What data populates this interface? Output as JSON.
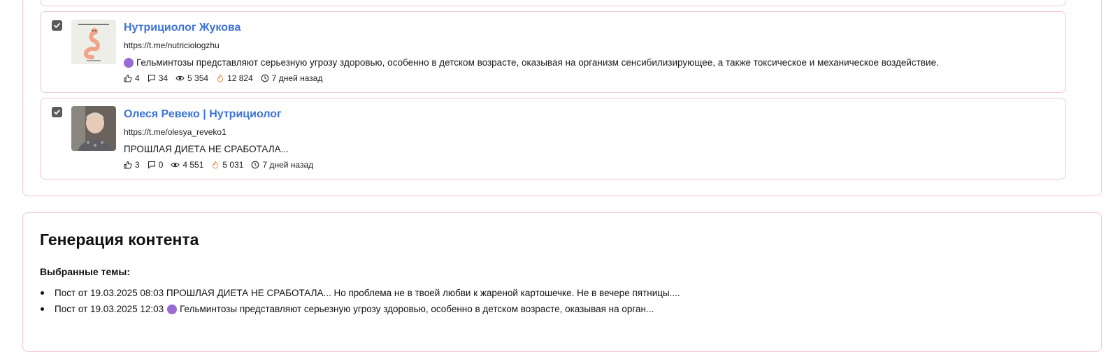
{
  "posts": [
    {
      "checked": true,
      "title": "Нутрициолог Жукова",
      "url": "https://t.me/nutriciologzhu",
      "text": "Гельминтозы представляют серьезную угрозу здоровью, особенно в детском возрасте, оказывая на организм сенсибилизирующее, а также токсическое и механическое воздействие.",
      "has_emoji_dot": true,
      "likes": "4",
      "comments": "34",
      "views": "5 354",
      "reach": "12 824",
      "time": "7 дней назад"
    },
    {
      "checked": true,
      "title": "Олеся Ревеко | Нутрициолог",
      "url": "https://t.me/olesya_reveko1",
      "text": "ПРОШЛАЯ ДИЕТА НЕ СРАБОТАЛА...",
      "has_emoji_dot": false,
      "likes": "3",
      "comments": "0",
      "views": "4 551",
      "reach": "5 031",
      "time": "7 дней назад"
    }
  ],
  "generation": {
    "title": "Генерация контента",
    "topics_label": "Выбранные темы:",
    "topics": [
      "Пост от 19.03.2025 08:03 ПРОШЛАЯ ДИЕТА НЕ СРАБОТАЛА... Но проблема не в твоей любви к жареной картошечке. Не в вечере пятницы....",
      "Гельминтозы представляют серьезную угрозу здоровью, особенно в детском возрасте, оказывая на орган..."
    ],
    "topic_2_prefix": "Пост от 19.03.2025 12:03"
  },
  "colors": {
    "accent_link": "#3b73d9",
    "border_pink": "#f3c6d6",
    "emoji_purple": "#9a6bd2",
    "fire_orange": "#f08a3c"
  },
  "icons": [
    "check-icon",
    "thumbs-up-icon",
    "comment-icon",
    "eye-icon",
    "fire-icon",
    "clock-icon"
  ]
}
